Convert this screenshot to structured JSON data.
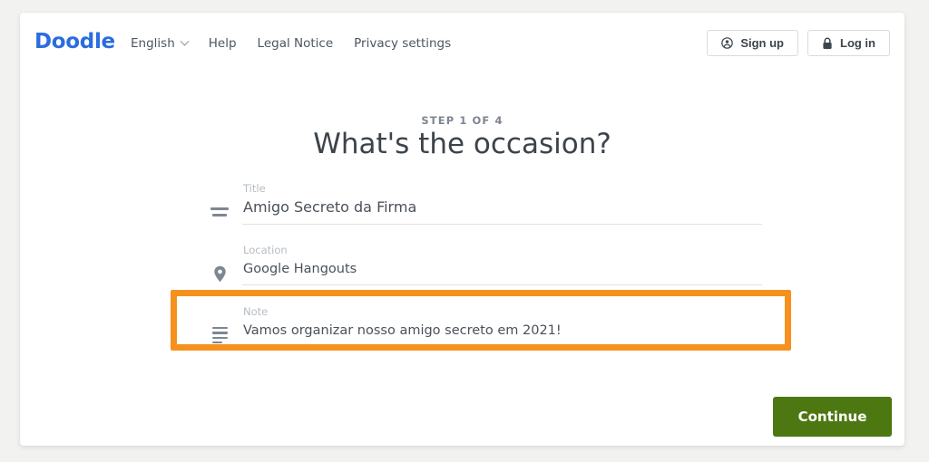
{
  "page": {
    "background_color": "#f2f2f0",
    "card_background": "#ffffff"
  },
  "header": {
    "logo_text": "Doodle",
    "logo_color": "#2b6cdf",
    "nav": [
      {
        "label": "English",
        "icon": "chevron-down-icon",
        "has_dropdown": true
      },
      {
        "label": "Help",
        "has_dropdown": false
      },
      {
        "label": "Legal Notice",
        "has_dropdown": false
      },
      {
        "label": "Privacy settings",
        "has_dropdown": false
      }
    ],
    "auth": {
      "signup_label": "Sign up",
      "signup_icon": "user-icon",
      "login_label": "Log in",
      "login_icon": "lock-icon"
    }
  },
  "main": {
    "step_label": "STEP 1 OF 4",
    "step_current": 1,
    "step_total": 4,
    "title": "What's the occasion?",
    "fields": [
      {
        "name": "title",
        "icon": "title-lines-icon",
        "label": "Title",
        "value": "Amigo Secreto da Firma",
        "placeholder": ""
      },
      {
        "name": "location",
        "icon": "map-pin-icon",
        "label": "Location",
        "value": "Google Hangouts",
        "placeholder": ""
      },
      {
        "name": "note",
        "icon": "note-lines-icon",
        "label": "Note",
        "value": "Vamos organizar nosso amigo secreto em 2021!",
        "placeholder": "",
        "highlighted": true
      }
    ],
    "highlight": {
      "color": "#f6911e",
      "target": "note-field"
    },
    "continue_label": "Continue",
    "continue_color": "#4d7711"
  }
}
